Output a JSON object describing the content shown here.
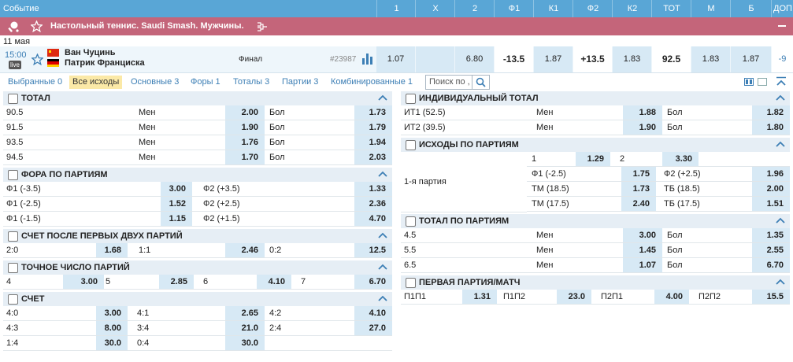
{
  "header": {
    "event_label": "Событие",
    "columns": [
      "1",
      "X",
      "2",
      "Ф1",
      "К1",
      "Ф2",
      "К2",
      "ТОТ",
      "М",
      "Б",
      "ДОП"
    ]
  },
  "league": {
    "title": "Настольный теннис. Saudi Smash. Мужчины."
  },
  "date": "11 мая",
  "match": {
    "time": "15:00",
    "live": "live",
    "team1": "Ван Чуцинь",
    "team2": "Патрик Франциска",
    "stage": "Финал",
    "id": "#23987",
    "odds": [
      "1.07",
      "",
      "6.80",
      "-13.5",
      "1.87",
      "+13.5",
      "1.83",
      "92.5",
      "1.83",
      "1.87",
      "-9"
    ]
  },
  "tabs": [
    {
      "label": "Выбранные 0"
    },
    {
      "label": "Все исходы"
    },
    {
      "label": "Основные 3"
    },
    {
      "label": "Форы 1"
    },
    {
      "label": "Тоталы 3"
    },
    {
      "label": "Партии 3"
    },
    {
      "label": "Комбинированные 1"
    }
  ],
  "search": {
    "placeholder": "Поиск по ,"
  },
  "sections": {
    "total": {
      "title": "ТОТАЛ",
      "rows": [
        {
          "name": "90.5",
          "l1": "Мен",
          "o1": "2.00",
          "l2": "Бол",
          "o2": "1.73"
        },
        {
          "name": "91.5",
          "l1": "Мен",
          "o1": "1.90",
          "l2": "Бол",
          "o2": "1.79"
        },
        {
          "name": "93.5",
          "l1": "Мен",
          "o1": "1.76",
          "l2": "Бол",
          "o2": "1.94"
        },
        {
          "name": "94.5",
          "l1": "Мен",
          "o1": "1.70",
          "l2": "Бол",
          "o2": "2.03"
        }
      ]
    },
    "fora": {
      "title": "ФОРА ПО ПАРТИЯМ",
      "rows": [
        {
          "l1": "Ф1 (-3.5)",
          "o1": "3.00",
          "l2": "Ф2 (+3.5)",
          "o2": "1.33"
        },
        {
          "l1": "Ф1 (-2.5)",
          "o1": "1.52",
          "l2": "Ф2 (+2.5)",
          "o2": "2.36"
        },
        {
          "l1": "Ф1 (-1.5)",
          "o1": "1.15",
          "l2": "Ф2 (+1.5)",
          "o2": "4.70"
        }
      ]
    },
    "first_two": {
      "title": "СЧЕТ ПОСЛЕ ПЕРВЫХ ДВУХ ПАРТИЙ",
      "row": [
        {
          "l": "2:0",
          "o": "1.68"
        },
        {
          "l": "1:1",
          "o": "2.46"
        },
        {
          "l": "0:2",
          "o": "12.5"
        }
      ]
    },
    "exact": {
      "title": "ТОЧНОЕ ЧИСЛО ПАРТИЙ",
      "row": [
        {
          "l": "4",
          "o": "3.00"
        },
        {
          "l": "5",
          "o": "2.85"
        },
        {
          "l": "6",
          "o": "4.10"
        },
        {
          "l": "7",
          "o": "6.70"
        }
      ]
    },
    "score": {
      "title": "СЧЕТ",
      "rows": [
        [
          {
            "l": "4:0",
            "o": "3.00"
          },
          {
            "l": "4:1",
            "o": "2.65"
          },
          {
            "l": "4:2",
            "o": "4.10"
          }
        ],
        [
          {
            "l": "4:3",
            "o": "8.00"
          },
          {
            "l": "3:4",
            "o": "21.0"
          },
          {
            "l": "2:4",
            "o": "27.0"
          }
        ],
        [
          {
            "l": "1:4",
            "o": "30.0"
          },
          {
            "l": "0:4",
            "o": "30.0"
          }
        ]
      ]
    },
    "ind_total": {
      "title": "ИНДИВИДУАЛЬНЫЙ ТОТАЛ",
      "rows": [
        {
          "name": "ИТ1 (52.5)",
          "l1": "Мен",
          "o1": "1.88",
          "l2": "Бол",
          "o2": "1.82"
        },
        {
          "name": "ИТ2 (39.5)",
          "l1": "Мен",
          "o1": "1.90",
          "l2": "Бол",
          "o2": "1.80"
        }
      ]
    },
    "outcomes": {
      "title": "ИСХОДЫ ПО ПАРТИЯМ",
      "part_label": "1-я партия",
      "top": [
        {
          "l": "1",
          "o": "1.29"
        },
        {
          "l": "2",
          "o": "3.30"
        }
      ],
      "rows": [
        {
          "l1": "Ф1 (-2.5)",
          "o1": "1.75",
          "l2": "Ф2 (+2.5)",
          "o2": "1.96"
        },
        {
          "l1": "ТМ (18.5)",
          "o1": "1.73",
          "l2": "ТБ (18.5)",
          "o2": "2.00"
        },
        {
          "l1": "ТМ (17.5)",
          "o1": "2.40",
          "l2": "ТБ (17.5)",
          "o2": "1.51"
        }
      ]
    },
    "total_parts": {
      "title": "ТОТАЛ ПО ПАРТИЯМ",
      "rows": [
        {
          "name": "4.5",
          "l1": "Мен",
          "o1": "3.00",
          "l2": "Бол",
          "o2": "1.35"
        },
        {
          "name": "5.5",
          "l1": "Мен",
          "o1": "1.45",
          "l2": "Бол",
          "o2": "2.55"
        },
        {
          "name": "6.5",
          "l1": "Мен",
          "o1": "1.07",
          "l2": "Бол",
          "o2": "6.70"
        }
      ]
    },
    "first_match": {
      "title": "ПЕРВАЯ ПАРТИЯ/МАТЧ",
      "row": [
        {
          "l": "П1П1",
          "o": "1.31"
        },
        {
          "l": "П1П2",
          "o": "23.0"
        },
        {
          "l": "П2П1",
          "o": "4.00"
        },
        {
          "l": "П2П2",
          "o": "15.5"
        }
      ]
    },
    "colors": {
      "header": "#59a6d6",
      "league": "#c4657a",
      "odd": "#d7e9f5",
      "section": "#e6eef5"
    }
  }
}
